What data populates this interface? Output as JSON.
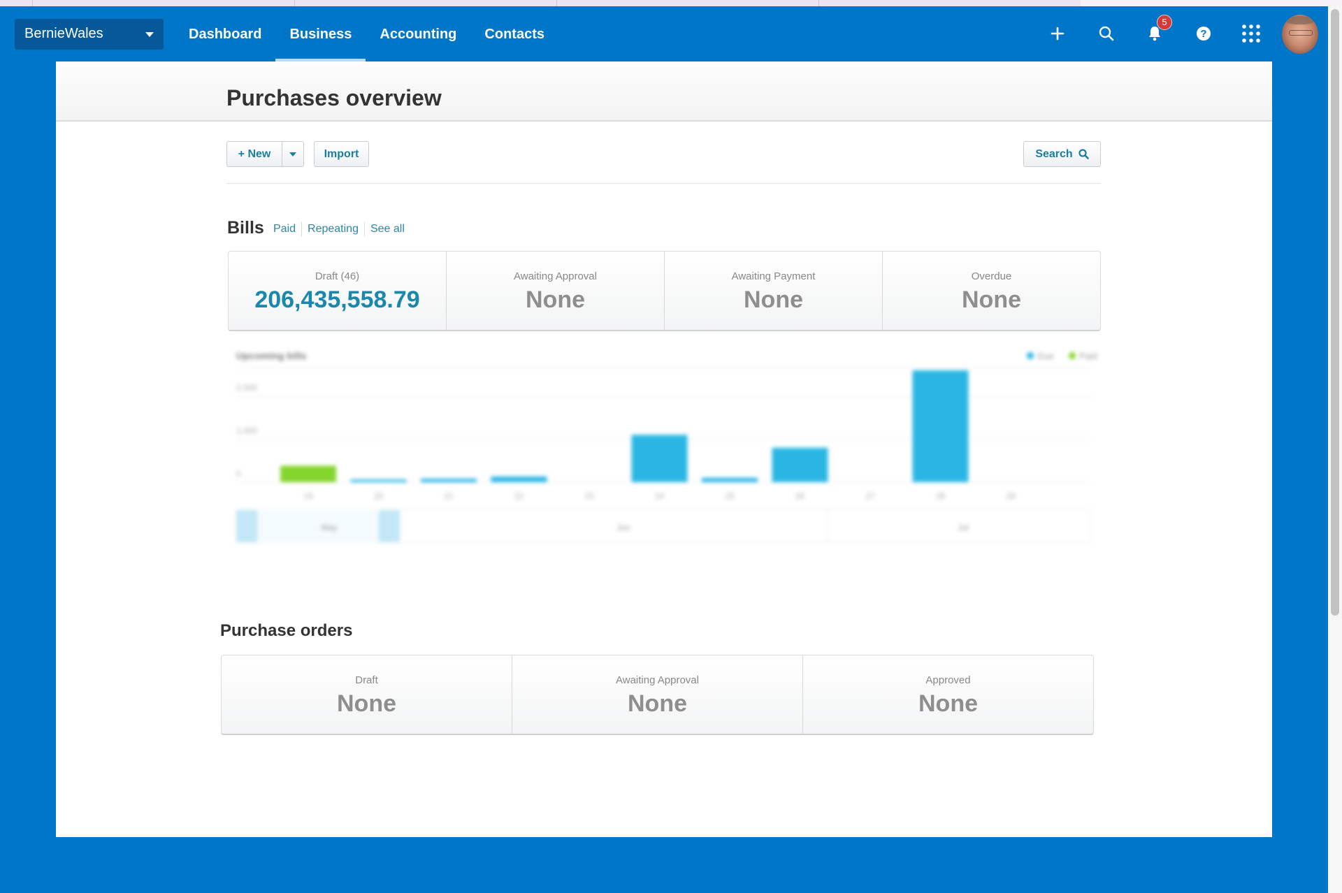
{
  "nav": {
    "org_name": "BernieWales",
    "links": [
      {
        "label": "Dashboard",
        "active": false
      },
      {
        "label": "Business",
        "active": true
      },
      {
        "label": "Accounting",
        "active": false
      },
      {
        "label": "Contacts",
        "active": false
      }
    ],
    "icons": [
      "plus-icon",
      "search-icon",
      "bell-icon",
      "help-icon",
      "apps-grid-icon"
    ],
    "notification_count": "5"
  },
  "page": {
    "title": "Purchases overview"
  },
  "toolbar": {
    "new_label": "+ New",
    "import_label": "Import",
    "search_label": "Search"
  },
  "bills": {
    "title": "Bills",
    "links": [
      "Paid",
      "Repeating",
      "See all"
    ],
    "stats": [
      {
        "label": "Draft (46)",
        "value": "206,435,558.79",
        "accent": true
      },
      {
        "label": "Awaiting Approval",
        "value": "None",
        "accent": false
      },
      {
        "label": "Awaiting Payment",
        "value": "None",
        "accent": false
      },
      {
        "label": "Overdue",
        "value": "None",
        "accent": false
      }
    ]
  },
  "purchase_orders": {
    "title": "Purchase orders",
    "stats": [
      {
        "label": "Draft",
        "value": "None"
      },
      {
        "label": "Awaiting Approval",
        "value": "None"
      },
      {
        "label": "Approved",
        "value": "None"
      }
    ]
  },
  "colors": {
    "brand": "#0076c8",
    "accent_text": "#1a87ad",
    "due": "#1fb3e3",
    "paid": "#7ed321",
    "badge": "#d43a3a"
  },
  "chart_data": {
    "type": "bar",
    "title": "Upcoming bills",
    "state": "loading (blurred)",
    "categories": [
      "19",
      "20",
      "21",
      "22",
      "23",
      "24",
      "25",
      "26",
      "27",
      "28",
      "29"
    ],
    "series": [
      {
        "name": "Due",
        "values": [
          0,
          60,
          80,
          130,
          0,
          1100,
          100,
          800,
          0,
          2600,
          0
        ]
      },
      {
        "name": "Paid",
        "values": [
          380,
          0,
          0,
          0,
          0,
          0,
          0,
          0,
          0,
          0,
          0
        ]
      }
    ],
    "yticks": [
      "0",
      "1,000",
      "2,000"
    ],
    "ylim": [
      0,
      2600
    ],
    "legend": [
      "Due",
      "Paid"
    ],
    "legend_position": "top-right",
    "navigator_labels": [
      "May",
      "Jun",
      "Jul"
    ],
    "grid": true
  }
}
